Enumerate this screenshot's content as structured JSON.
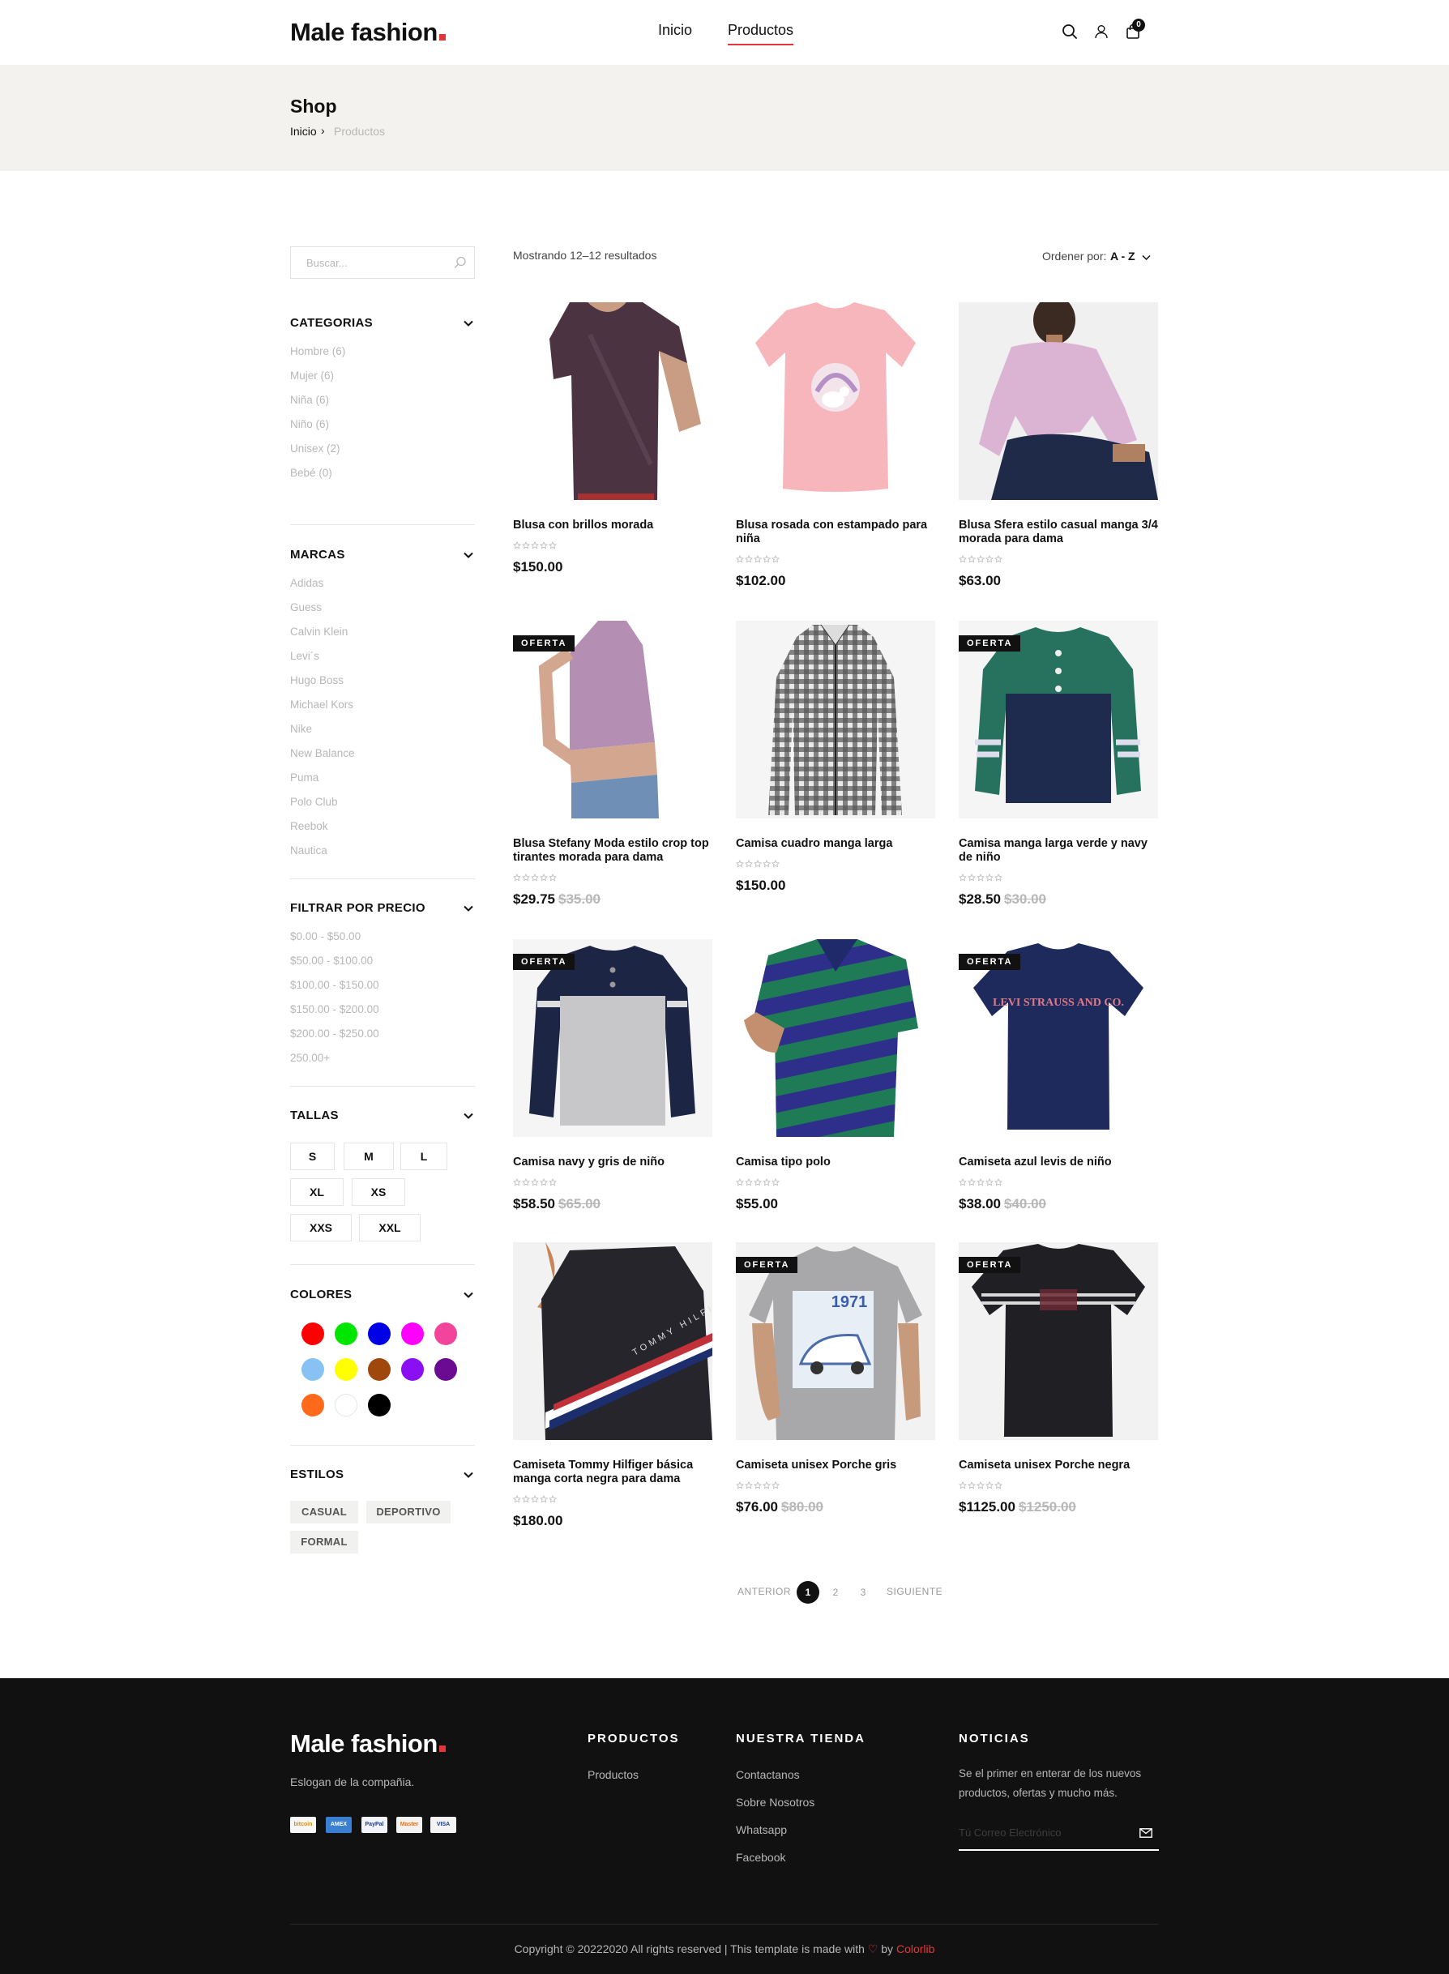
{
  "header": {
    "logo": "Male fashion",
    "nav": [
      "Inicio",
      "Productos"
    ],
    "active_nav": "Productos",
    "cart_count": "0",
    "accent_color": "#e53637"
  },
  "breadcrumb": {
    "title": "Shop",
    "home": "Inicio",
    "separator": "›",
    "current": "Productos"
  },
  "sidebar": {
    "search_placeholder": "Buscar...",
    "categories": {
      "title": "CATEGORIAS",
      "items": [
        "Hombre (6)",
        "Mujer (6)",
        "Niña (6)",
        "Niño (6)",
        "Unisex (2)",
        "Bebé (0)"
      ]
    },
    "brands": {
      "title": "MARCAS",
      "items": [
        "Adidas",
        "Guess",
        "Calvin Klein",
        "Levi´s",
        "Hugo Boss",
        "Michael Kors",
        "Nike",
        "New Balance",
        "Puma",
        "Polo Club",
        "Reebok",
        "Nautica"
      ]
    },
    "price": {
      "title": "FILTRAR POR PRECIO",
      "items": [
        "$0.00 - $50.00",
        "$50.00 - $100.00",
        "$100.00 - $150.00",
        "$150.00 - $200.00",
        "$200.00 - $250.00",
        "250.00+"
      ]
    },
    "sizes": {
      "title": "TALLAS",
      "items": [
        "S",
        "M",
        "L",
        "XL",
        "XS",
        "XXS",
        "XXL"
      ]
    },
    "colors": {
      "title": "COLORES",
      "items": [
        "#ff0000",
        "#00e600",
        "#0000e6",
        "#ff00ff",
        "#f2449a",
        "#88c2f5",
        "#ffff00",
        "#a0470d",
        "#8a0ff2",
        "#6a0b91",
        "#ff6a1a",
        "#ffffff",
        "#000000"
      ]
    },
    "styles": {
      "title": "ESTILOS",
      "items": [
        "CASUAL",
        "DEPORTIVO",
        "FORMAL"
      ]
    }
  },
  "toolbar": {
    "results": "Mostrando 12–12 resultados",
    "sort_label": "Ordener por:",
    "sort_value": "A - Z"
  },
  "products": [
    {
      "name": "Blusa con brillos morada",
      "price": "$150.00",
      "old_price": "",
      "badge": ""
    },
    {
      "name": "Blusa rosada con estampado para niña",
      "price": "$102.00",
      "old_price": "",
      "badge": ""
    },
    {
      "name": "Blusa Sfera estilo casual manga 3/4 morada para dama",
      "price": "$63.00",
      "old_price": "",
      "badge": ""
    },
    {
      "name": "Blusa Stefany Moda estilo crop top tirantes morada para dama",
      "price": "$29.75",
      "old_price": "$35.00",
      "badge": "OFERTA"
    },
    {
      "name": "Camisa cuadro manga larga",
      "price": "$150.00",
      "old_price": "",
      "badge": ""
    },
    {
      "name": "Camisa manga larga verde y navy de niño",
      "price": "$28.50",
      "old_price": "$30.00",
      "badge": "OFERTA"
    },
    {
      "name": "Camisa navy y gris de niño",
      "price": "$58.50",
      "old_price": "$65.00",
      "badge": "OFERTA"
    },
    {
      "name": "Camisa tipo polo",
      "price": "$55.00",
      "old_price": "",
      "badge": ""
    },
    {
      "name": "Camiseta azul levis de niño",
      "price": "$38.00",
      "old_price": "$40.00",
      "badge": "OFERTA"
    },
    {
      "name": "Camiseta Tommy Hilfiger básica manga corta negra para dama",
      "price": "$180.00",
      "old_price": "",
      "badge": ""
    },
    {
      "name": "Camiseta unisex Porche gris",
      "price": "$76.00",
      "old_price": "$80.00",
      "badge": "OFERTA"
    },
    {
      "name": "Camiseta unisex Porche negra",
      "price": "$1125.00",
      "old_price": "$1250.00",
      "badge": "OFERTA"
    }
  ],
  "product_art": {
    "levis_print": "LEVI STRAUSS AND CO.",
    "tommy_print": "TOMMY HILFIGER",
    "porsche_print": "1971"
  },
  "pagination": {
    "prev": "ANTERIOR",
    "pages": [
      "1",
      "2",
      "3"
    ],
    "next": "SIGUIENTE",
    "current": "1"
  },
  "footer": {
    "logo": "Male fashion",
    "slogan": "Eslogan de la compañia.",
    "payments": [
      "bitcoin",
      "AMEX",
      "PayPal",
      "Master",
      "VISA"
    ],
    "col_products": {
      "title": "PRODUCTOS",
      "links": [
        "Productos"
      ]
    },
    "col_store": {
      "title": "NUESTRA TIENDA",
      "links": [
        "Contactanos",
        "Sobre Nosotros",
        "Whatsapp",
        "Facebook"
      ]
    },
    "col_news": {
      "title": "NOTICIAS",
      "text": "Se el primer en enterar de los nuevos productos, ofertas y mucho más.",
      "email_placeholder": "Tú Correo Electrónico"
    },
    "copyright_pre": "Copyright © 20222020 All rights reserved | This template is made with",
    "copyright_by": "by",
    "copyright_brand": "Colorlib"
  }
}
